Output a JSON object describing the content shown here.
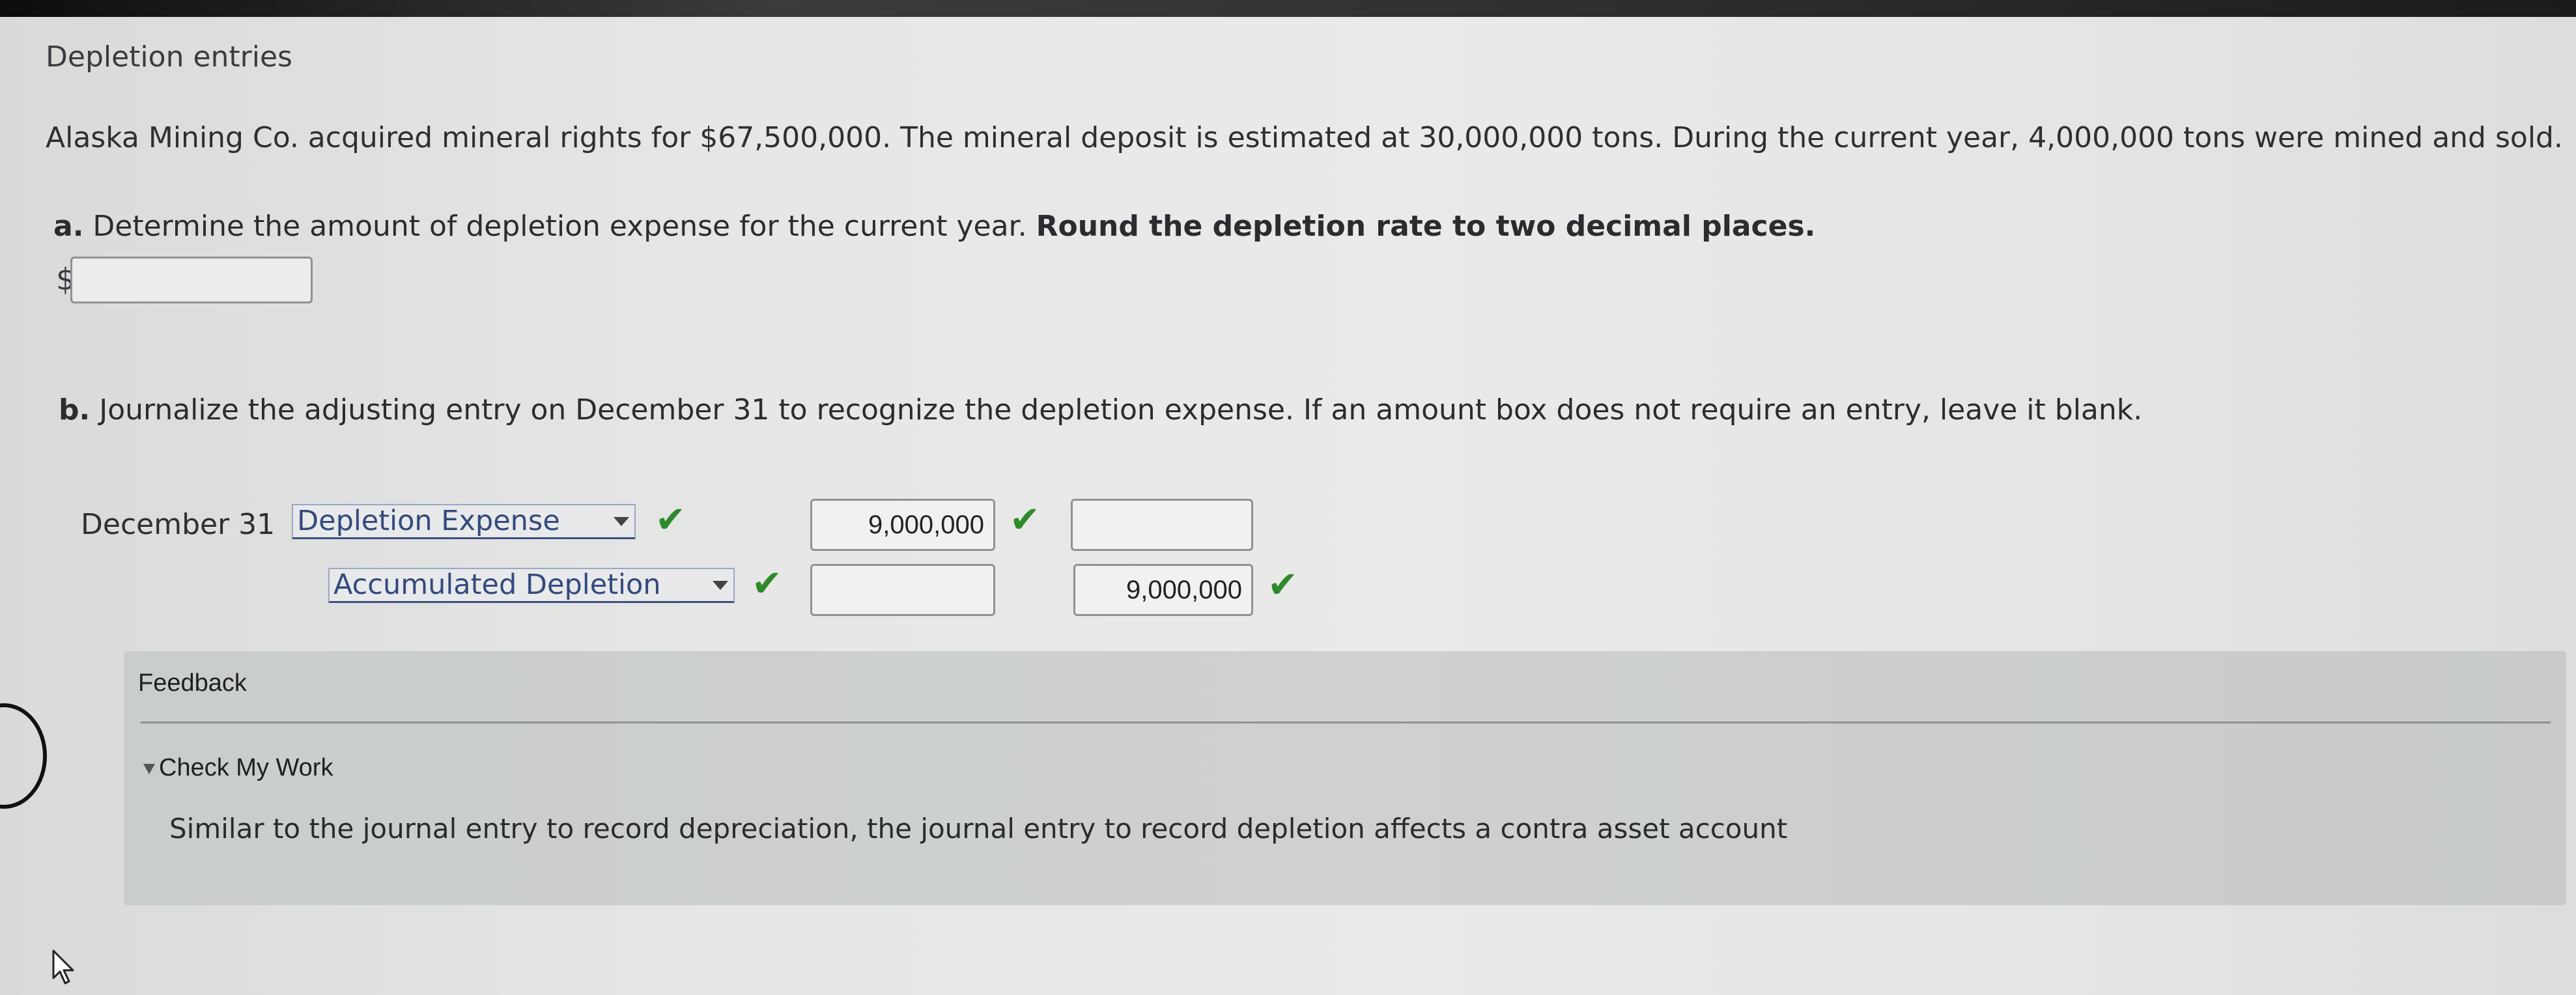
{
  "section_title": "Depletion entries",
  "problem_text": "Alaska Mining Co. acquired mineral rights for $67,500,000. The mineral deposit is estimated at 30,000,000 tons. During the current year, 4,000,000 tons were mined and sold.",
  "part_a": {
    "letter": "a.",
    "text": "Determine the amount of depletion expense for the current year.",
    "bold_text": "Round the depletion rate to two decimal places.",
    "currency": "$",
    "value": ""
  },
  "part_b": {
    "letter": "b.",
    "text": "Journalize the adjusting entry on December 31 to recognize the depletion expense. If an amount box does not require an entry, leave it blank."
  },
  "journal": {
    "date": "December 31",
    "rows": [
      {
        "account": "Depletion Expense",
        "debit": "9,000,000",
        "credit": ""
      },
      {
        "account": "Accumulated Depletion",
        "debit": "",
        "credit": "9,000,000"
      }
    ],
    "check_mark": "✔"
  },
  "feedback": {
    "title": "Feedback",
    "toggle_label": "Check My Work",
    "text": "Similar to the journal entry to record depreciation, the journal entry to record depletion affects a contra asset account"
  },
  "colors": {
    "check": "#2f8a2c",
    "link_text": "#344a7e",
    "feedback_bg": "#ced1cf"
  }
}
